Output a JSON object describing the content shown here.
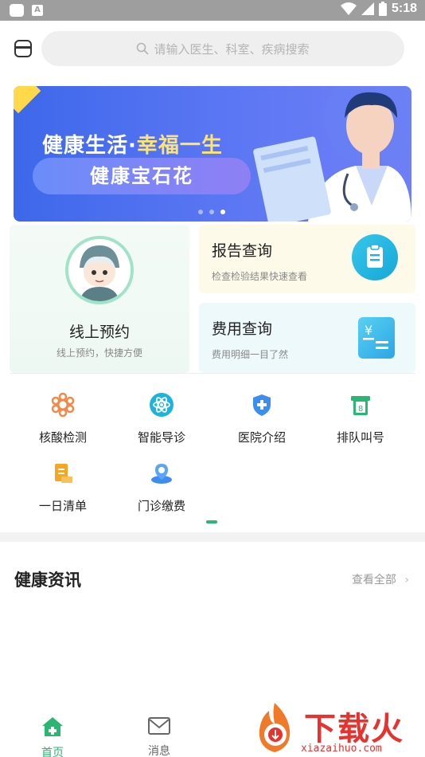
{
  "status_bar": {
    "time": "5:18"
  },
  "search": {
    "placeholder": "请输入医生、科室、疾病搜索"
  },
  "banner": {
    "title_part1": "健康生活·",
    "title_part2": "幸福一生",
    "subtitle": "健康宝石花",
    "dots_total": 3,
    "active_dot": 3
  },
  "cards": {
    "appointment": {
      "title": "线上预约",
      "subtitle": "线上预约，快捷方便"
    },
    "report": {
      "title": "报告查询",
      "subtitle": "检查检验结果快速查看"
    },
    "fee": {
      "title": "费用查询",
      "subtitle": "费用明细一目了然"
    }
  },
  "functions": [
    {
      "label": "核酸检测",
      "icon": "nucleic-acid-icon"
    },
    {
      "label": "智能导诊",
      "icon": "smart-guide-icon"
    },
    {
      "label": "医院介绍",
      "icon": "hospital-shield-icon"
    },
    {
      "label": "排队叫号",
      "icon": "queue-ticket-icon"
    },
    {
      "label": "一日清单",
      "icon": "daily-list-icon"
    },
    {
      "label": "门诊缴费",
      "icon": "outpatient-payment-icon"
    }
  ],
  "news": {
    "title": "健康资讯",
    "more": "查看全部"
  },
  "bottom_nav": [
    {
      "label": "首页",
      "icon": "home-icon",
      "active": true
    },
    {
      "label": "消息",
      "icon": "mail-icon",
      "active": false
    }
  ],
  "watermark": {
    "text": "下载火",
    "url": "xiazaihuo.com"
  },
  "colors": {
    "accent": "#2bb673",
    "banner_blue": "#4a6cf0",
    "banner_highlight": "#ffe36b"
  }
}
